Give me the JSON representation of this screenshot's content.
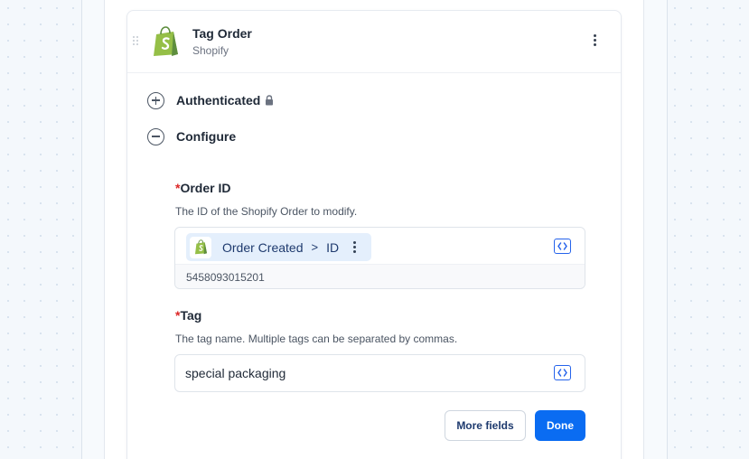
{
  "step": {
    "title": "Tag Order",
    "app": "Shopify",
    "sections": {
      "authenticated_label": "Authenticated",
      "configure_label": "Configure"
    },
    "fields": {
      "order_id": {
        "required_mark": "*",
        "label": "Order ID",
        "description": "The ID of the Shopify Order to modify.",
        "pill_source": "Order Created",
        "pill_separator": ">",
        "pill_field": "ID",
        "resolved_value": "5458093015201"
      },
      "tag": {
        "required_mark": "*",
        "label": "Tag",
        "description": "The tag name. Multiple tags can be separated by commas.",
        "value": "special packaging"
      }
    },
    "buttons": {
      "more_fields": "More fields",
      "done": "Done"
    }
  },
  "colors": {
    "shopify_green": "#95bf47",
    "primary_blue": "#0a6cf2",
    "required_red": "#dc2626",
    "pill_bg": "#e4effc"
  },
  "icons": {
    "app_logo": "shopify-bag-icon",
    "menu": "kebab-menu-icon",
    "expand": "plus-circle-icon",
    "collapse": "minus-circle-icon",
    "locked": "lock-icon",
    "code": "code-brackets-icon"
  }
}
